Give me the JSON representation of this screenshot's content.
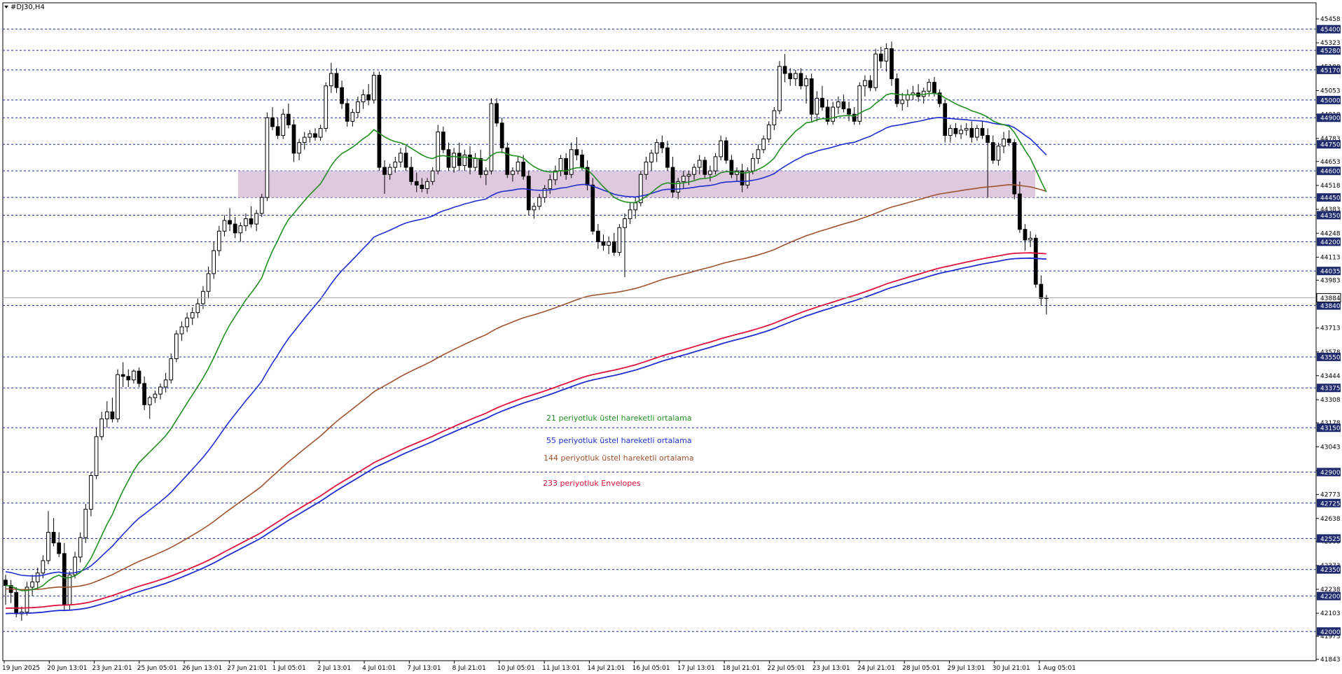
{
  "chart_data": {
    "type": "candlestick",
    "symbol": "#DJ30,H4",
    "ylim": [
      41843,
      45458
    ],
    "y_ticks": [
      45458,
      45323,
      45188,
      45053,
      44918,
      44783,
      44653,
      44518,
      44383,
      44248,
      44113,
      43983,
      43848,
      43713,
      43578,
      43444,
      43308,
      43178,
      43043,
      42908,
      42773,
      42638,
      42508,
      42373,
      42238,
      42103,
      41973,
      41843
    ],
    "price_levels": [
      45400,
      45280,
      45170,
      45000,
      44900,
      44750,
      44600,
      44450,
      44350,
      44200,
      44035,
      43840,
      43550,
      43375,
      43150,
      42900,
      42725,
      42525,
      42350,
      42200,
      42000
    ],
    "current_price": 43884,
    "x_labels": [
      "19 Jun 2025",
      "20 Jun 13:01",
      "23 Jun 21:01",
      "25 Jun 05:01",
      "26 Jun 13:01",
      "27 Jun 21:01",
      "1 Jul 05:01",
      "2 Jul 13:01",
      "4 Jul 01:01",
      "7 Jul 13:01",
      "8 Jul 21:01",
      "10 Jul 05:01",
      "11 Jul 13:01",
      "14 Jul 21:01",
      "16 Jul 05:01",
      "17 Jul 13:01",
      "18 Jul 21:01",
      "22 Jul 05:01",
      "23 Jul 13:01",
      "24 Jul 21:01",
      "28 Jul 05:01",
      "29 Jul 13:01",
      "30 Jul 21:01",
      "1 Aug 05:01"
    ],
    "zone": {
      "from": 44450,
      "to": 44600,
      "color": "#d8bfd8"
    },
    "colors": {
      "grid": "#1f2f9f",
      "ema21": "#1f8f1f",
      "ema55": "#1f2fcf",
      "ema144": "#a0522d",
      "env_upper": "#e0103c",
      "env_lower": "#1f2fcf",
      "label_bg": "#1e2a6e",
      "current_bg": "#ffffff"
    },
    "legend": [
      {
        "text": "21 periyotluk üstel hareketli ortalama",
        "color": "#1f8f1f"
      },
      {
        "text": "55 periyotluk üstel hareketli ortalama",
        "color": "#1f2fcf"
      },
      {
        "text": "144 periyotluk üstel hareketli ortalama",
        "color": "#a0522d"
      },
      {
        "text": "233 periyotluk Envelopes",
        "color": "#e0103c"
      }
    ],
    "candles": [
      [
        42290,
        42320,
        42150,
        42260
      ],
      [
        42260,
        42290,
        42160,
        42220
      ],
      [
        42220,
        42250,
        42080,
        42100
      ],
      [
        42100,
        42140,
        42060,
        42110
      ],
      [
        42110,
        42280,
        42090,
        42250
      ],
      [
        42250,
        42320,
        42200,
        42280
      ],
      [
        42280,
        42360,
        42240,
        42330
      ],
      [
        42330,
        42430,
        42300,
        42400
      ],
      [
        42400,
        42680,
        42380,
        42560
      ],
      [
        42560,
        42640,
        42480,
        42500
      ],
      [
        42500,
        42560,
        42420,
        42440
      ],
      [
        42440,
        42500,
        42120,
        42150
      ],
      [
        42150,
        42340,
        42120,
        42320
      ],
      [
        42320,
        42450,
        42300,
        42420
      ],
      [
        42420,
        42560,
        42390,
        42530
      ],
      [
        42530,
        42720,
        42500,
        42690
      ],
      [
        42690,
        42900,
        42650,
        42880
      ],
      [
        42880,
        43150,
        42860,
        43100
      ],
      [
        43100,
        43240,
        43080,
        43200
      ],
      [
        43200,
        43300,
        43150,
        43240
      ],
      [
        43240,
        43320,
        43180,
        43200
      ],
      [
        43200,
        43480,
        43180,
        43450
      ],
      [
        43450,
        43520,
        43380,
        43440
      ],
      [
        43440,
        43480,
        43380,
        43420
      ],
      [
        43420,
        43480,
        43400,
        43470
      ],
      [
        43470,
        43490,
        43380,
        43400
      ],
      [
        43400,
        43440,
        43250,
        43280
      ],
      [
        43280,
        43330,
        43200,
        43320
      ],
      [
        43320,
        43360,
        43290,
        43340
      ],
      [
        43340,
        43400,
        43310,
        43380
      ],
      [
        43380,
        43460,
        43350,
        43420
      ],
      [
        43420,
        43570,
        43400,
        43540
      ],
      [
        43540,
        43700,
        43520,
        43680
      ],
      [
        43680,
        43750,
        43640,
        43720
      ],
      [
        43720,
        43800,
        43690,
        43770
      ],
      [
        43770,
        43830,
        43730,
        43800
      ],
      [
        43800,
        43880,
        43770,
        43850
      ],
      [
        43850,
        43950,
        43820,
        43920
      ],
      [
        43920,
        44060,
        43880,
        44020
      ],
      [
        44020,
        44200,
        43990,
        44150
      ],
      [
        44150,
        44290,
        44120,
        44260
      ],
      [
        44260,
        44350,
        44230,
        44320
      ],
      [
        44320,
        44390,
        44260,
        44300
      ],
      [
        44300,
        44340,
        44220,
        44250
      ],
      [
        44250,
        44310,
        44200,
        44290
      ],
      [
        44290,
        44360,
        44260,
        44330
      ],
      [
        44330,
        44400,
        44280,
        44300
      ],
      [
        44300,
        44380,
        44260,
        44360
      ],
      [
        44360,
        44470,
        44340,
        44450
      ],
      [
        44450,
        44930,
        44430,
        44900
      ],
      [
        44900,
        44960,
        44830,
        44850
      ],
      [
        44850,
        44900,
        44780,
        44800
      ],
      [
        44800,
        44950,
        44780,
        44920
      ],
      [
        44920,
        44980,
        44840,
        44860
      ],
      [
        44860,
        44890,
        44650,
        44700
      ],
      [
        44700,
        44780,
        44660,
        44760
      ],
      [
        44760,
        44820,
        44720,
        44790
      ],
      [
        44790,
        44830,
        44760,
        44810
      ],
      [
        44810,
        44840,
        44770,
        44790
      ],
      [
        44790,
        44860,
        44770,
        44840
      ],
      [
        44840,
        45100,
        44820,
        45080
      ],
      [
        45080,
        45210,
        45040,
        45150
      ],
      [
        45150,
        45180,
        45040,
        45070
      ],
      [
        45070,
        45110,
        44950,
        44980
      ],
      [
        44980,
        45010,
        44850,
        44880
      ],
      [
        44880,
        44950,
        44850,
        44930
      ],
      [
        44930,
        45020,
        44900,
        44990
      ],
      [
        44990,
        45060,
        44950,
        45030
      ],
      [
        45030,
        45090,
        44970,
        45000
      ],
      [
        45000,
        45160,
        44980,
        45140
      ],
      [
        45140,
        45160,
        44600,
        44620
      ],
      [
        44620,
        44660,
        44470,
        44580
      ],
      [
        44580,
        44640,
        44550,
        44620
      ],
      [
        44620,
        44680,
        44590,
        44650
      ],
      [
        44650,
        44730,
        44620,
        44700
      ],
      [
        44700,
        44740,
        44600,
        44620
      ],
      [
        44620,
        44680,
        44520,
        44540
      ],
      [
        44540,
        44590,
        44480,
        44520
      ],
      [
        44520,
        44560,
        44480,
        44500
      ],
      [
        44500,
        44560,
        44470,
        44540
      ],
      [
        44540,
        44620,
        44520,
        44600
      ],
      [
        44600,
        44860,
        44580,
        44820
      ],
      [
        44820,
        44850,
        44700,
        44720
      ],
      [
        44720,
        44760,
        44600,
        44620
      ],
      [
        44620,
        44730,
        44590,
        44700
      ],
      [
        44700,
        44760,
        44600,
        44630
      ],
      [
        44630,
        44720,
        44600,
        44690
      ],
      [
        44690,
        44740,
        44580,
        44620
      ],
      [
        44620,
        44700,
        44600,
        44670
      ],
      [
        44670,
        44720,
        44560,
        44580
      ],
      [
        44580,
        44620,
        44520,
        44600
      ],
      [
        44600,
        45010,
        44580,
        44980
      ],
      [
        44980,
        45010,
        44850,
        44870
      ],
      [
        44870,
        44900,
        44700,
        44730
      ],
      [
        44730,
        44760,
        44560,
        44580
      ],
      [
        44580,
        44620,
        44540,
        44600
      ],
      [
        44600,
        44680,
        44580,
        44650
      ],
      [
        44650,
        44690,
        44550,
        44570
      ],
      [
        44570,
        44600,
        44350,
        44380
      ],
      [
        44380,
        44420,
        44330,
        44400
      ],
      [
        44400,
        44470,
        44380,
        44450
      ],
      [
        44450,
        44520,
        44420,
        44500
      ],
      [
        44500,
        44580,
        44470,
        44550
      ],
      [
        44550,
        44630,
        44520,
        44600
      ],
      [
        44600,
        44690,
        44570,
        44670
      ],
      [
        44670,
        44700,
        44550,
        44580
      ],
      [
        44580,
        44760,
        44560,
        44720
      ],
      [
        44720,
        44790,
        44660,
        44690
      ],
      [
        44690,
        44720,
        44600,
        44620
      ],
      [
        44620,
        44660,
        44490,
        44520
      ],
      [
        44520,
        44560,
        44240,
        44260
      ],
      [
        44260,
        44300,
        44160,
        44200
      ],
      [
        44200,
        44240,
        44150,
        44180
      ],
      [
        44180,
        44230,
        44130,
        44200
      ],
      [
        44200,
        44250,
        44120,
        44140
      ],
      [
        44140,
        44300,
        44120,
        44280
      ],
      [
        44280,
        44360,
        44000,
        44330
      ],
      [
        44330,
        44420,
        44300,
        44380
      ],
      [
        44380,
        44450,
        44330,
        44420
      ],
      [
        44420,
        44600,
        44400,
        44580
      ],
      [
        44580,
        44680,
        44550,
        44650
      ],
      [
        44650,
        44720,
        44600,
        44700
      ],
      [
        44700,
        44780,
        44650,
        44760
      ],
      [
        44760,
        44800,
        44700,
        44730
      ],
      [
        44730,
        44770,
        44600,
        44620
      ],
      [
        44620,
        44680,
        44450,
        44480
      ],
      [
        44480,
        44560,
        44440,
        44540
      ],
      [
        44540,
        44600,
        44500,
        44570
      ],
      [
        44570,
        44600,
        44520,
        44580
      ],
      [
        44580,
        44640,
        44550,
        44620
      ],
      [
        44620,
        44690,
        44580,
        44660
      ],
      [
        44660,
        44680,
        44560,
        44580
      ],
      [
        44580,
        44630,
        44540,
        44600
      ],
      [
        44600,
        44700,
        44580,
        44680
      ],
      [
        44680,
        44800,
        44660,
        44770
      ],
      [
        44770,
        44790,
        44640,
        44660
      ],
      [
        44660,
        44690,
        44560,
        44580
      ],
      [
        44580,
        44620,
        44540,
        44600
      ],
      [
        44600,
        44640,
        44480,
        44520
      ],
      [
        44520,
        44620,
        44500,
        44600
      ],
      [
        44600,
        44700,
        44580,
        44670
      ],
      [
        44670,
        44750,
        44640,
        44720
      ],
      [
        44720,
        44800,
        44700,
        44780
      ],
      [
        44780,
        44880,
        44760,
        44860
      ],
      [
        44860,
        44960,
        44830,
        44940
      ],
      [
        44940,
        45220,
        44920,
        45190
      ],
      [
        45190,
        45260,
        45100,
        45150
      ],
      [
        45150,
        45180,
        45080,
        45120
      ],
      [
        45120,
        45170,
        45080,
        45150
      ],
      [
        45150,
        45180,
        45060,
        45080
      ],
      [
        45080,
        45140,
        44980,
        45120
      ],
      [
        45120,
        45150,
        44880,
        44920
      ],
      [
        44920,
        45050,
        44880,
        45010
      ],
      [
        45010,
        45080,
        44940,
        44960
      ],
      [
        44960,
        45000,
        44860,
        44880
      ],
      [
        44880,
        44990,
        44860,
        44960
      ],
      [
        44960,
        45020,
        44920,
        44990
      ],
      [
        44990,
        45030,
        44930,
        44950
      ],
      [
        44950,
        44990,
        44880,
        44920
      ],
      [
        44920,
        44960,
        44860,
        44880
      ],
      [
        44880,
        45100,
        44860,
        45080
      ],
      [
        45080,
        45140,
        45020,
        45110
      ],
      [
        45110,
        45140,
        45050,
        45070
      ],
      [
        45070,
        45290,
        45050,
        45260
      ],
      [
        45260,
        45300,
        45180,
        45220
      ],
      [
        45220,
        45320,
        45160,
        45290
      ],
      [
        45290,
        45330,
        45080,
        45120
      ],
      [
        45120,
        45150,
        44960,
        44980
      ],
      [
        44980,
        45040,
        44940,
        45000
      ],
      [
        45000,
        45060,
        44960,
        45030
      ],
      [
        45030,
        45080,
        45000,
        45040
      ],
      [
        45040,
        45090,
        44990,
        45020
      ],
      [
        45020,
        45070,
        44980,
        45050
      ],
      [
        45050,
        45120,
        45020,
        45100
      ],
      [
        45100,
        45130,
        45020,
        45040
      ],
      [
        45040,
        45060,
        44960,
        44980
      ],
      [
        44980,
        45000,
        44760,
        44800
      ],
      [
        44800,
        44860,
        44760,
        44840
      ],
      [
        44840,
        44870,
        44790,
        44810
      ],
      [
        44810,
        44860,
        44780,
        44830
      ],
      [
        44830,
        44870,
        44800,
        44840
      ],
      [
        44840,
        44880,
        44760,
        44790
      ],
      [
        44790,
        44860,
        44770,
        44840
      ],
      [
        44840,
        44880,
        44780,
        44800
      ],
      [
        44800,
        44840,
        44450,
        44760
      ],
      [
        44760,
        44800,
        44640,
        44660
      ],
      [
        44660,
        44760,
        44630,
        44740
      ],
      [
        44740,
        44820,
        44700,
        44780
      ],
      [
        44780,
        44830,
        44740,
        44760
      ],
      [
        44760,
        44780,
        44440,
        44470
      ],
      [
        44470,
        44540,
        44250,
        44270
      ],
      [
        44270,
        44300,
        44150,
        44210
      ],
      [
        44210,
        44260,
        44170,
        44220
      ],
      [
        44220,
        44240,
        43940,
        43960
      ],
      [
        43960,
        44010,
        43840,
        43880
      ],
      [
        43880,
        43900,
        43790,
        43884
      ]
    ]
  }
}
